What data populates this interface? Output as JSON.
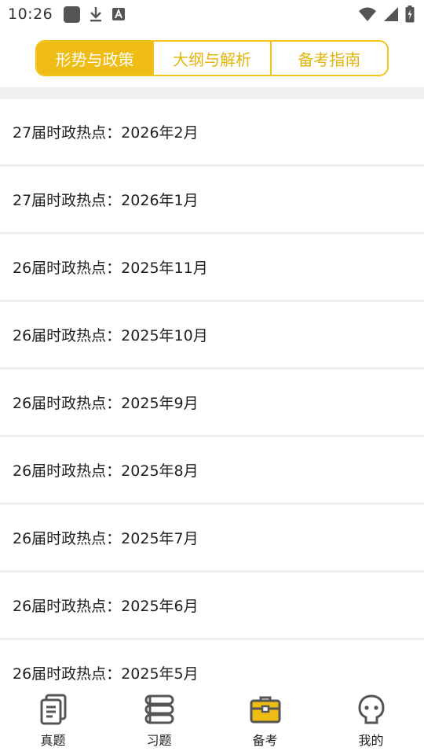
{
  "status_bar": {
    "time": "10:26",
    "left_icons": [
      "app-square-icon",
      "download-icon",
      "text-a-icon"
    ],
    "right_icons": [
      "wifi-icon",
      "signal-icon",
      "battery-charging-icon"
    ]
  },
  "tabs": [
    {
      "label": "形势与政策",
      "active": true
    },
    {
      "label": "大纲与解析",
      "active": false
    },
    {
      "label": "备考指南",
      "active": false
    }
  ],
  "list": [
    {
      "title": "27届时政热点：2026年2月"
    },
    {
      "title": "27届时政热点：2026年1月"
    },
    {
      "title": "26届时政热点：2025年11月"
    },
    {
      "title": "26届时政热点：2025年10月"
    },
    {
      "title": "26届时政热点：2025年9月"
    },
    {
      "title": "26届时政热点：2025年8月"
    },
    {
      "title": "26届时政热点：2025年7月"
    },
    {
      "title": "26届时政热点：2025年6月"
    },
    {
      "title": "26届时政热点：2025年5月"
    }
  ],
  "bottom_nav": [
    {
      "label": "真题",
      "icon": "document-stack-icon",
      "active": false
    },
    {
      "label": "习题",
      "icon": "books-stack-icon",
      "active": false
    },
    {
      "label": "备考",
      "icon": "briefcase-icon",
      "active": true
    },
    {
      "label": "我的",
      "icon": "face-icon",
      "active": false
    }
  ],
  "colors": {
    "accent": "#eebc13",
    "accent_border": "#f0c419",
    "divider": "#efefef",
    "text": "#1f1f1f"
  }
}
